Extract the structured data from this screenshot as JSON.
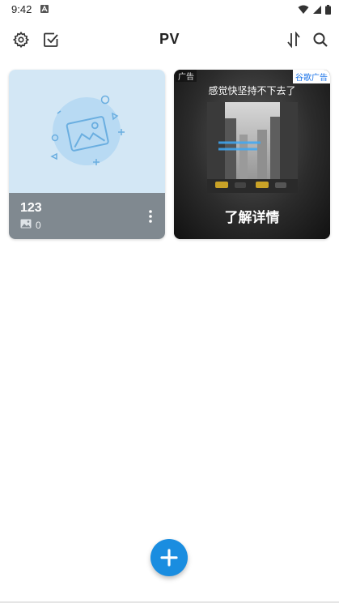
{
  "status_bar": {
    "time": "9:42"
  },
  "app_bar": {
    "title": "PV"
  },
  "albums": [
    {
      "name": "123",
      "count": "0"
    }
  ],
  "ad": {
    "label": "广告",
    "brand": "谷歌广告",
    "headline": "感觉快坚持不下去了",
    "cta": "了解详情"
  },
  "colors": {
    "accent": "#1a8de0",
    "album_footer": "#808990",
    "album_thumb_bg": "#d3e7f5",
    "placeholder_icon": "#6aaee0"
  },
  "icons": {
    "settings": "gear-icon",
    "select": "checkbox-icon",
    "sort": "sort-icon",
    "search": "search-icon",
    "add": "plus-icon",
    "more": "more-vertical-icon"
  }
}
